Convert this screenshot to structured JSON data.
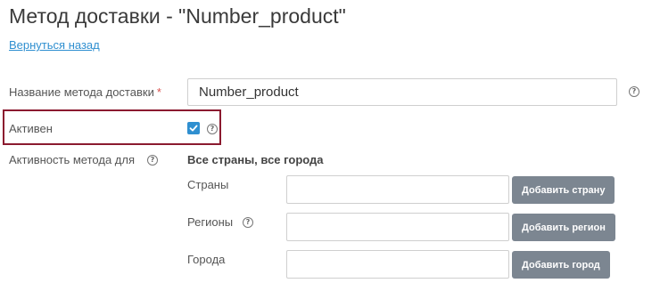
{
  "header": {
    "title": "Метод доставки - \"Number_product\"",
    "back_link": "Вернуться назад"
  },
  "form": {
    "name_label": "Название метода доставки",
    "required_mark": "*",
    "name_value": "Number_product",
    "active_label": "Активен",
    "active_checked": true,
    "activity_label": "Активность метода для",
    "activity_value": "Все страны, все города",
    "countries_label": "Страны",
    "countries_value": "",
    "countries_button": "Добавить страну",
    "regions_label": "Регионы",
    "regions_value": "",
    "regions_button": "Добавить регион",
    "cities_label": "Города",
    "cities_value": "",
    "cities_button": "Добавить город"
  },
  "icons": {
    "help": "help-icon",
    "check": "check-icon"
  },
  "colors": {
    "link": "#2f8fd0",
    "checkbox": "#2f8fd0",
    "button": "#7c8691",
    "highlight": "#8b1a2f",
    "required": "#d9534f"
  }
}
